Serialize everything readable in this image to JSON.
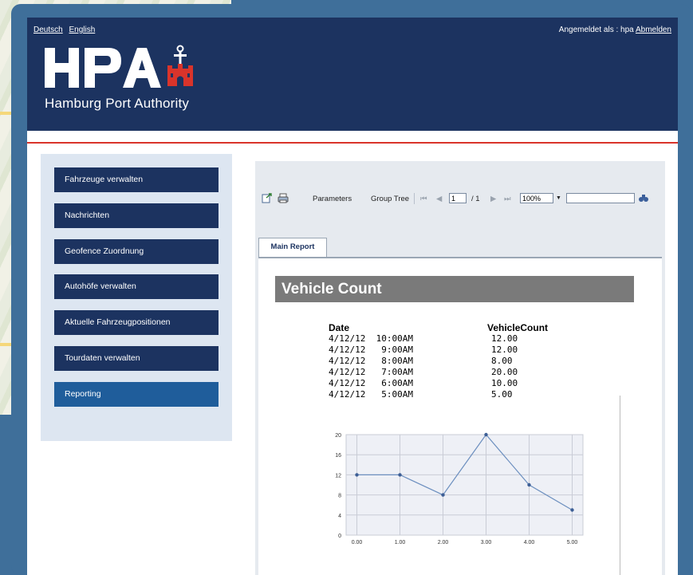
{
  "header": {
    "languages": [
      "Deutsch",
      "English"
    ],
    "login_prefix": "Angemeldet als : hpa",
    "logout_label": "Abmelden",
    "logo_text": "HPA",
    "logo_tagline": "Hamburg Port Authority"
  },
  "sidebar": {
    "items": [
      {
        "label": "Fahrzeuge verwalten"
      },
      {
        "label": "Nachrichten"
      },
      {
        "label": "Geofence Zuordnung"
      },
      {
        "label": "Autohöfe verwalten"
      },
      {
        "label": "Aktuelle Fahrzeugpositionen"
      },
      {
        "label": "Tourdaten verwalten"
      },
      {
        "label": "Reporting"
      }
    ],
    "active_index": 6
  },
  "toolbar": {
    "parameters_label": "Parameters",
    "group_tree_label": "Group Tree",
    "page_value": "1",
    "page_total": "/ 1",
    "zoom_value": "100%"
  },
  "tabs": [
    {
      "label": "Main Report"
    }
  ],
  "report": {
    "title": "Vehicle Count",
    "col_date": "Date",
    "col_count": "VehicleCount",
    "rows": [
      {
        "date": "4/12/12  10:00AM",
        "count": "12.00"
      },
      {
        "date": "4/12/12   9:00AM",
        "count": "12.00"
      },
      {
        "date": "4/12/12   8:00AM",
        "count": "8.00"
      },
      {
        "date": "4/12/12   7:00AM",
        "count": "20.00"
      },
      {
        "date": "4/12/12   6:00AM",
        "count": "10.00"
      },
      {
        "date": "4/12/12   5:00AM",
        "count": "5.00"
      }
    ]
  },
  "chart_data": {
    "type": "line",
    "x": [
      0.0,
      1.0,
      2.0,
      3.0,
      4.0,
      5.0
    ],
    "x_tick_labels": [
      "0.00",
      "1.00",
      "2.00",
      "3.00",
      "4.00",
      "5.00"
    ],
    "y_ticks": [
      0,
      4,
      8,
      12,
      16,
      20
    ],
    "y_tick_labels": [
      "0",
      "4",
      "8",
      "12",
      "16",
      "20"
    ],
    "series": [
      {
        "values": [
          12,
          12,
          8,
          20,
          10,
          5
        ]
      }
    ],
    "xlim": [
      -0.25,
      5.25
    ],
    "ylim": [
      0,
      20
    ],
    "grid": true,
    "line_color": "#6c8fbf"
  },
  "colors": {
    "header_bg": "#1c3360",
    "accent_red": "#d9342b",
    "nav_active": "#1f5d9b"
  }
}
